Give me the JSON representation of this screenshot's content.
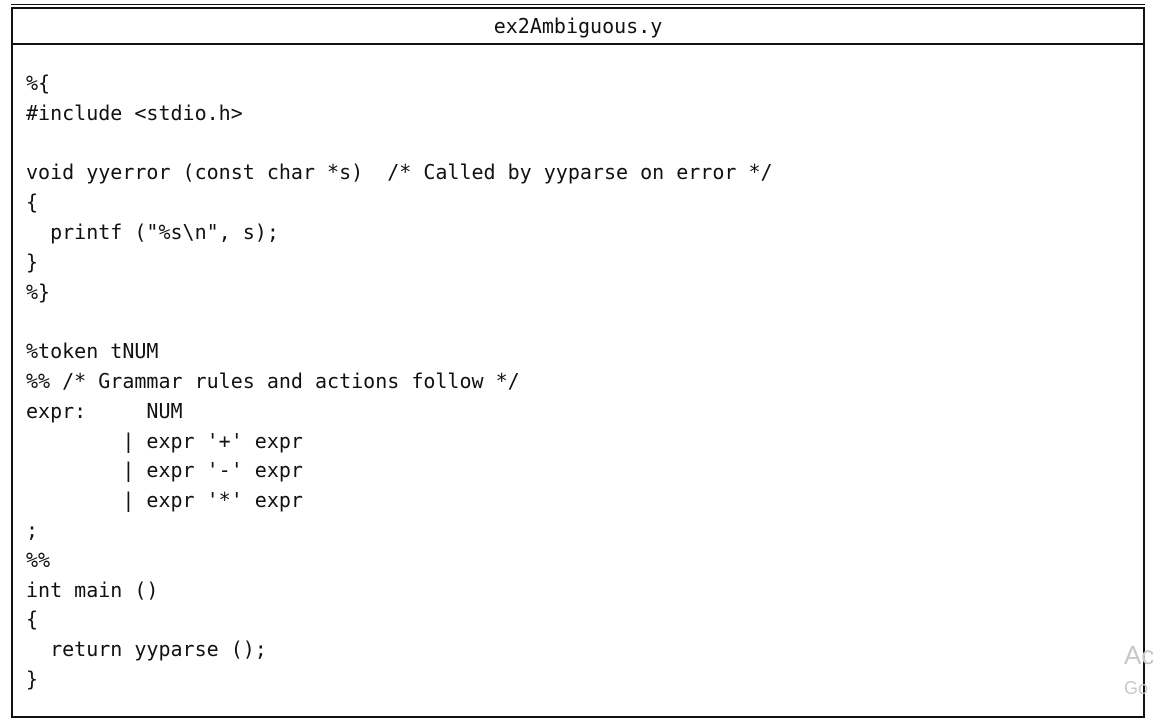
{
  "document": {
    "title": "ex2Ambiguous.y",
    "code_lines": [
      "%{",
      "#include <stdio.h>",
      "",
      "void yyerror (const char *s)  /* Called by yyparse on error */",
      "{",
      "  printf (\"%s\\n\", s);",
      "}",
      "%}",
      "",
      "%token tNUM",
      "%% /* Grammar rules and actions follow */",
      "expr:     NUM",
      "        | expr '+' expr",
      "        | expr '-' expr",
      "        | expr '*' expr",
      ";",
      "%%",
      "int main ()",
      "{",
      "  return yyparse ();",
      "}"
    ]
  },
  "watermark": {
    "line1": "Ac",
    "line2": "Go"
  }
}
